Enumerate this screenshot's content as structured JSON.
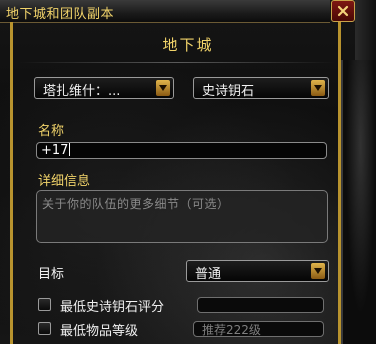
{
  "window": {
    "title": "地下城和团队副本",
    "close_glyph": "close-icon"
  },
  "panel": {
    "heading": "地下城"
  },
  "filters": {
    "dungeon_select": "塔扎维什：...",
    "type_select": "史诗钥石"
  },
  "form": {
    "name_label": "名称",
    "name_value": "+17",
    "details_label": "详细信息",
    "details_placeholder": "关于你的队伍的更多细节（可选）",
    "goal_label": "目标",
    "goal_select": "普通",
    "min_keystone_label": "最低史诗钥石评分",
    "min_keystone_checked": false,
    "min_keystone_value": "",
    "min_ilvl_label": "最低物品等级",
    "min_ilvl_checked": false,
    "min_ilvl_placeholder": "推荐222级"
  },
  "colors": {
    "gold_text": "#f1d36a",
    "frame_gold": "#b8932e",
    "close_red": "#7e1712"
  }
}
